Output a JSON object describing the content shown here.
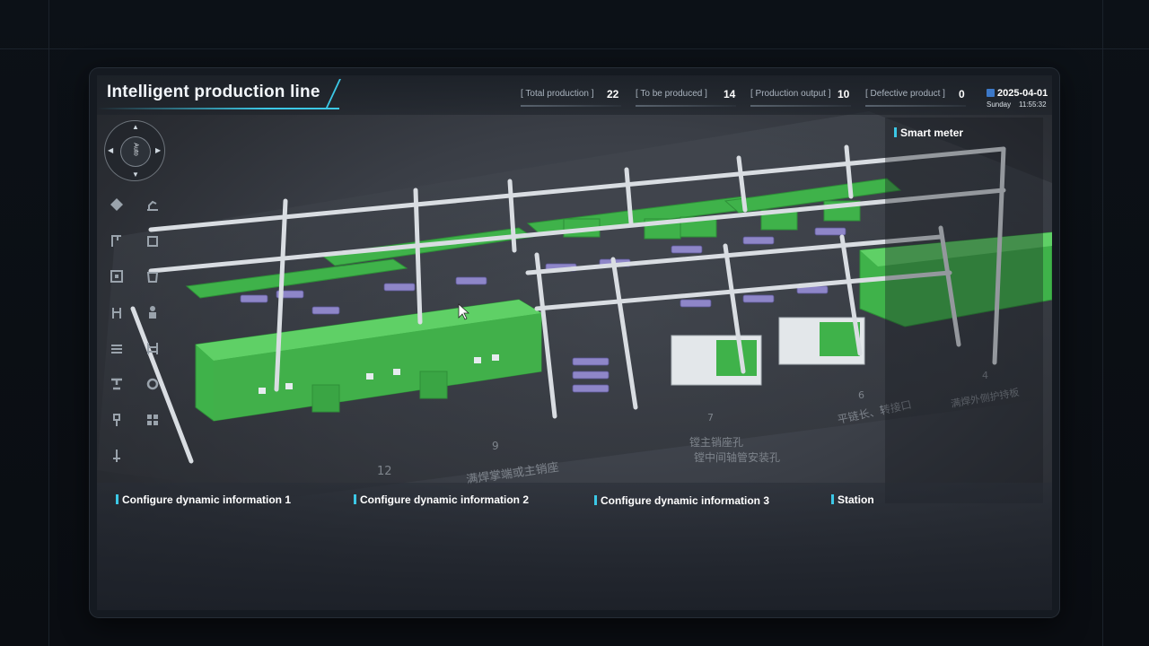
{
  "header": {
    "title": "Intelligent production line",
    "stats": [
      {
        "label": "[ Total production ]",
        "value": "22"
      },
      {
        "label": "[ To be produced ]",
        "value": "14"
      },
      {
        "label": "[ Production output ]",
        "value": "10"
      },
      {
        "label": "[ Defective product ]",
        "value": "0"
      }
    ],
    "date": "2025-04-01",
    "weekday": "Sunday",
    "time": "11:55:32"
  },
  "compass": {
    "label": "Auto"
  },
  "side_panel": {
    "title": "Smart meter"
  },
  "bottom_sections": [
    {
      "title": "Configure dynamic information 1"
    },
    {
      "title": "Configure dynamic information 2"
    },
    {
      "title": "Configure dynamic information 3"
    },
    {
      "title": "Station"
    }
  ],
  "floor_labels": {
    "n4": "4",
    "n6": "6",
    "n7": "7",
    "n9": "9",
    "n12": "12",
    "text_a": "镗主销座孔",
    "text_b": "镗中间轴管安装孔",
    "text_c": "满焊掌端或主销座",
    "text_d": "平链长、转接口",
    "text_e": "满焊外侧护持板"
  },
  "tools": [
    {
      "icon": "view-cube-icon"
    },
    {
      "icon": "robot-arm-icon"
    },
    {
      "icon": "crane-icon"
    },
    {
      "icon": "box-icon"
    },
    {
      "icon": "frame-icon"
    },
    {
      "icon": "bin-icon"
    },
    {
      "icon": "lift-icon"
    },
    {
      "icon": "worker-icon"
    },
    {
      "icon": "conveyor-icon"
    },
    {
      "icon": "rack-icon"
    },
    {
      "icon": "press-icon"
    },
    {
      "icon": "gear-icon"
    },
    {
      "icon": "drill-icon"
    },
    {
      "icon": "grid-icon"
    },
    {
      "icon": "pin-icon"
    }
  ],
  "colors": {
    "accent": "#3cc8e6",
    "machine": "#3fb24a",
    "frame": "#d9dde2",
    "part": "#8e86c8"
  }
}
